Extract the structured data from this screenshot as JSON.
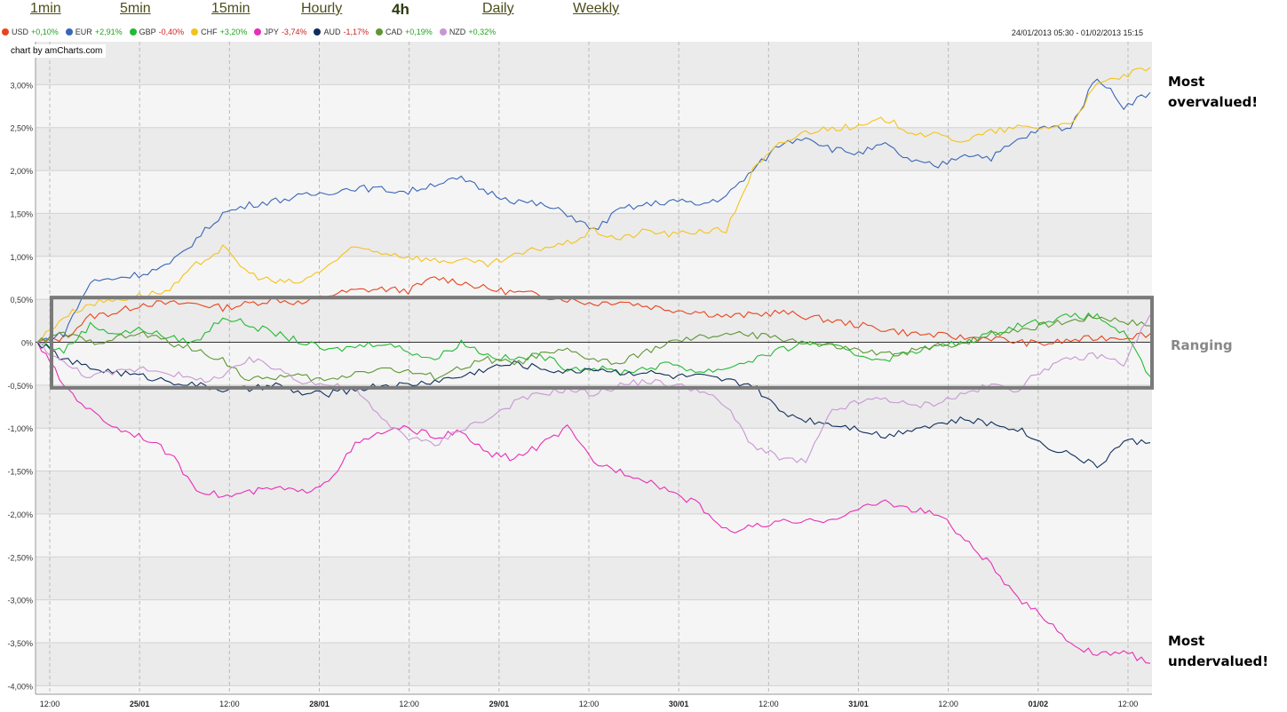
{
  "tabs": [
    {
      "label": "1min",
      "active": false
    },
    {
      "label": "5min",
      "active": false
    },
    {
      "label": "15min",
      "active": false
    },
    {
      "label": "Hourly",
      "active": false
    },
    {
      "label": "4h",
      "active": true
    },
    {
      "label": "Daily",
      "active": false
    },
    {
      "label": "Weekly",
      "active": false
    }
  ],
  "date_range": "24/01/2013 05:30 - 01/02/2013 15:15",
  "credit": "chart by amCharts.com",
  "annotations": {
    "overvalued": [
      "Most",
      "overvalued!"
    ],
    "ranging": "Ranging",
    "undervalued": [
      "Most",
      "undervalued!"
    ]
  },
  "colors": {
    "positive": "#1fa51f",
    "negative": "#cc2222",
    "band_dark": "#ebebeb",
    "band_light": "#f5f5f5",
    "grid": "#bbbbbb",
    "box": "#7a7a7a"
  },
  "chart_data": {
    "type": "line",
    "x_ticks": [
      "12:00",
      "25/01",
      "12:00",
      "28/01",
      "12:00",
      "29/01",
      "12:00",
      "30/01",
      "12:00",
      "31/01",
      "12:00",
      "01/02",
      "12:00"
    ],
    "y_ticks": [
      "3,00%",
      "2,50%",
      "2,00%",
      "1,50%",
      "1,00%",
      "0,50%",
      "0%",
      "-0,50%",
      "-1,00%",
      "-1,50%",
      "-2,00%",
      "-2,50%",
      "-3,00%",
      "-3,50%",
      "-4,00%"
    ],
    "ylim": [
      -4.1,
      3.5
    ],
    "y_unit": "%",
    "ranging_band": [
      -0.5,
      0.5
    ],
    "series": [
      {
        "name": "USD",
        "change": "+0,10%",
        "color": "#e8451e",
        "values": [
          0.0,
          0.05,
          0.3,
          0.35,
          0.45,
          0.45,
          0.45,
          0.4,
          0.45,
          0.5,
          0.45,
          0.55,
          0.6,
          0.62,
          0.6,
          0.75,
          0.7,
          0.62,
          0.58,
          0.55,
          0.5,
          0.45,
          0.48,
          0.42,
          0.38,
          0.35,
          0.3,
          0.32,
          0.35,
          0.3,
          0.25,
          0.2,
          0.15,
          0.1,
          0.08,
          0.05,
          0.05,
          0.0,
          -0.02,
          0.02,
          0.05,
          0.06,
          0.1
        ]
      },
      {
        "name": "EUR",
        "change": "+2,91%",
        "color": "#3a66b8",
        "values": [
          0.0,
          0.1,
          0.7,
          0.75,
          0.8,
          0.9,
          1.2,
          1.5,
          1.6,
          1.65,
          1.7,
          1.75,
          1.8,
          1.78,
          1.75,
          1.85,
          1.9,
          1.75,
          1.65,
          1.6,
          1.5,
          1.3,
          1.55,
          1.6,
          1.65,
          1.6,
          1.7,
          2.0,
          2.3,
          2.4,
          2.25,
          2.2,
          2.3,
          2.1,
          2.05,
          2.2,
          2.15,
          2.35,
          2.5,
          2.5,
          3.1,
          2.75,
          2.91
        ]
      },
      {
        "name": "GBP",
        "change": "-0,40%",
        "color": "#22bb33",
        "values": [
          0.0,
          -0.1,
          0.2,
          0.1,
          0.15,
          0.05,
          0.0,
          0.3,
          0.2,
          0.1,
          0.0,
          -0.1,
          -0.05,
          0.0,
          -0.1,
          -0.2,
          0.0,
          -0.15,
          -0.2,
          -0.15,
          -0.3,
          -0.3,
          -0.35,
          -0.3,
          -0.25,
          -0.35,
          -0.3,
          -0.2,
          -0.1,
          0.0,
          -0.05,
          -0.15,
          -0.2,
          -0.1,
          -0.05,
          0.0,
          0.1,
          0.2,
          0.25,
          0.3,
          0.3,
          0.1,
          -0.4
        ]
      },
      {
        "name": "CHF",
        "change": "+3,20%",
        "color": "#f4c31a",
        "values": [
          0.0,
          0.3,
          0.45,
          0.5,
          0.55,
          0.6,
          0.9,
          1.1,
          0.8,
          0.7,
          0.7,
          0.9,
          1.1,
          1.05,
          1.0,
          0.95,
          0.95,
          0.9,
          1.0,
          1.1,
          1.15,
          1.3,
          1.2,
          1.3,
          1.25,
          1.3,
          1.3,
          2.0,
          2.3,
          2.45,
          2.5,
          2.5,
          2.6,
          2.45,
          2.4,
          2.35,
          2.45,
          2.5,
          2.5,
          2.55,
          3.0,
          3.1,
          3.2
        ]
      },
      {
        "name": "JPY",
        "change": "-3,74%",
        "color": "#e82fb5",
        "values": [
          0.0,
          -0.5,
          -0.8,
          -1.0,
          -1.1,
          -1.3,
          -1.7,
          -1.8,
          -1.75,
          -1.7,
          -1.75,
          -1.6,
          -1.2,
          -1.05,
          -1.0,
          -1.1,
          -1.05,
          -1.3,
          -1.35,
          -1.2,
          -1.0,
          -1.4,
          -1.5,
          -1.6,
          -1.75,
          -1.9,
          -2.2,
          -2.15,
          -2.1,
          -2.1,
          -2.05,
          -1.95,
          -1.85,
          -1.95,
          -2.0,
          -2.3,
          -2.6,
          -3.0,
          -3.2,
          -3.5,
          -3.65,
          -3.6,
          -3.74
        ]
      },
      {
        "name": "AUD",
        "change": "-1,17%",
        "color": "#102e5c",
        "values": [
          0.0,
          -0.2,
          -0.3,
          -0.35,
          -0.4,
          -0.45,
          -0.5,
          -0.55,
          -0.55,
          -0.5,
          -0.6,
          -0.6,
          -0.55,
          -0.5,
          -0.5,
          -0.45,
          -0.4,
          -0.3,
          -0.25,
          -0.3,
          -0.35,
          -0.3,
          -0.35,
          -0.35,
          -0.4,
          -0.4,
          -0.45,
          -0.5,
          -0.8,
          -0.9,
          -0.95,
          -1.0,
          -1.1,
          -1.0,
          -0.95,
          -0.9,
          -0.95,
          -1.0,
          -1.2,
          -1.3,
          -1.45,
          -1.15,
          -1.17
        ]
      },
      {
        "name": "CAD",
        "change": "+0,19%",
        "color": "#5f9633",
        "values": [
          0.0,
          0.1,
          0.0,
          0.05,
          0.1,
          0.0,
          -0.1,
          -0.2,
          -0.45,
          -0.4,
          -0.4,
          -0.45,
          -0.35,
          -0.3,
          -0.35,
          -0.4,
          -0.3,
          -0.2,
          -0.25,
          -0.15,
          -0.1,
          -0.2,
          -0.25,
          -0.1,
          0.0,
          0.05,
          0.1,
          0.08,
          0.05,
          0.0,
          -0.05,
          -0.1,
          -0.15,
          -0.1,
          -0.05,
          0.0,
          0.1,
          0.15,
          0.2,
          0.25,
          0.3,
          0.25,
          0.19
        ]
      },
      {
        "name": "NZD",
        "change": "+0,32%",
        "color": "#c996d4",
        "values": [
          0.0,
          -0.25,
          -0.4,
          -0.35,
          -0.3,
          -0.35,
          -0.45,
          -0.4,
          -0.2,
          -0.3,
          -0.45,
          -0.5,
          -0.55,
          -0.9,
          -1.1,
          -1.2,
          -1.0,
          -0.9,
          -0.7,
          -0.6,
          -0.55,
          -0.6,
          -0.5,
          -0.45,
          -0.5,
          -0.55,
          -0.75,
          -1.2,
          -1.35,
          -1.4,
          -0.8,
          -0.7,
          -0.65,
          -0.75,
          -0.7,
          -0.6,
          -0.5,
          -0.55,
          -0.3,
          -0.2,
          -0.15,
          -0.25,
          0.32
        ]
      }
    ]
  }
}
